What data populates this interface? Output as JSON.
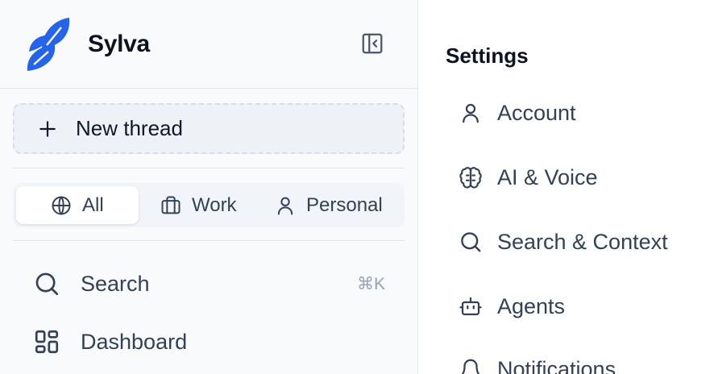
{
  "brand": {
    "name": "Sylva"
  },
  "sidebar": {
    "new_thread_label": "New thread",
    "filters": [
      {
        "label": "All",
        "icon": "globe-icon",
        "active": true
      },
      {
        "label": "Work",
        "icon": "briefcase-icon",
        "active": false
      },
      {
        "label": "Personal",
        "icon": "user-icon",
        "active": false
      }
    ],
    "nav": [
      {
        "label": "Search",
        "icon": "search-icon",
        "shortcut": "⌘K"
      },
      {
        "label": "Dashboard",
        "icon": "dashboard-icon"
      }
    ]
  },
  "settings": {
    "title": "Settings",
    "items": [
      {
        "label": "Account",
        "icon": "user-icon"
      },
      {
        "label": "AI & Voice",
        "icon": "brain-icon"
      },
      {
        "label": "Search & Context",
        "icon": "search-icon"
      },
      {
        "label": "Agents",
        "icon": "bot-icon"
      },
      {
        "label": "Notifications",
        "icon": "bell-icon"
      }
    ]
  },
  "colors": {
    "brand_blue": "#2563eb",
    "text": "#334155",
    "muted": "#94a3b8",
    "border": "#e2e8f0"
  }
}
